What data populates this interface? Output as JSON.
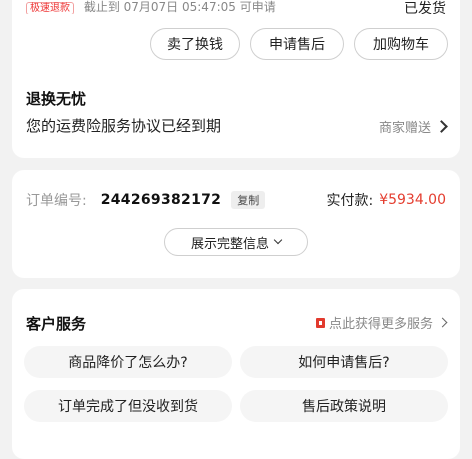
{
  "top_card": {
    "clipped_tag": "极速退款",
    "clipped_text": "截止到 07月07日 05:47:05 可申请",
    "clipped_right": "已发货",
    "buttons": [
      "卖了换钱",
      "申请售后",
      "加购物车"
    ],
    "title": "退换无忧",
    "desc": "您的运费险服务协议已经到期",
    "gift_label": "商家赠送"
  },
  "order": {
    "number_label": "订单编号:",
    "number": "244269382172",
    "copy_label": "复制",
    "paid_label": "实付款:",
    "paid_amount": "¥5934.00",
    "expand_label": "展示完整信息"
  },
  "service": {
    "title": "客户服务",
    "more_label": "点此获得更多服务",
    "faq": [
      "商品降价了怎么办?",
      "如何申请售后?",
      "订单完成了但没收到货",
      "售后政策说明"
    ]
  },
  "colors": {
    "accent_red": "#e43d2f",
    "card_bg": "#ffffff",
    "page_bg": "#f2f2f2"
  }
}
